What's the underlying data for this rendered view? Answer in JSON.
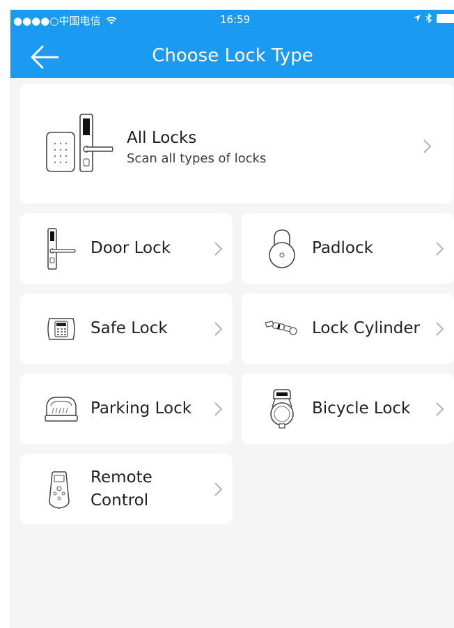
{
  "status_bar": {
    "carrier": "●●●●○中国电信",
    "time": "16:59"
  },
  "header": {
    "title": "Choose Lock Type"
  },
  "all_locks": {
    "title": "All Locks",
    "subtitle": "Scan all types of locks"
  },
  "lock_types": [
    {
      "label": "Door Lock"
    },
    {
      "label": "Padlock"
    },
    {
      "label": "Safe Lock"
    },
    {
      "label": "Lock Cylinder"
    },
    {
      "label": "Parking Lock"
    },
    {
      "label": "Bicycle Lock"
    },
    {
      "label_line1": "Remote",
      "label_line2": "Control"
    }
  ],
  "colors": {
    "header_bg": "#1a9af0",
    "page_bg": "#f5f5f5",
    "card_bg": "#ffffff",
    "chevron": "#b3b3b3"
  }
}
